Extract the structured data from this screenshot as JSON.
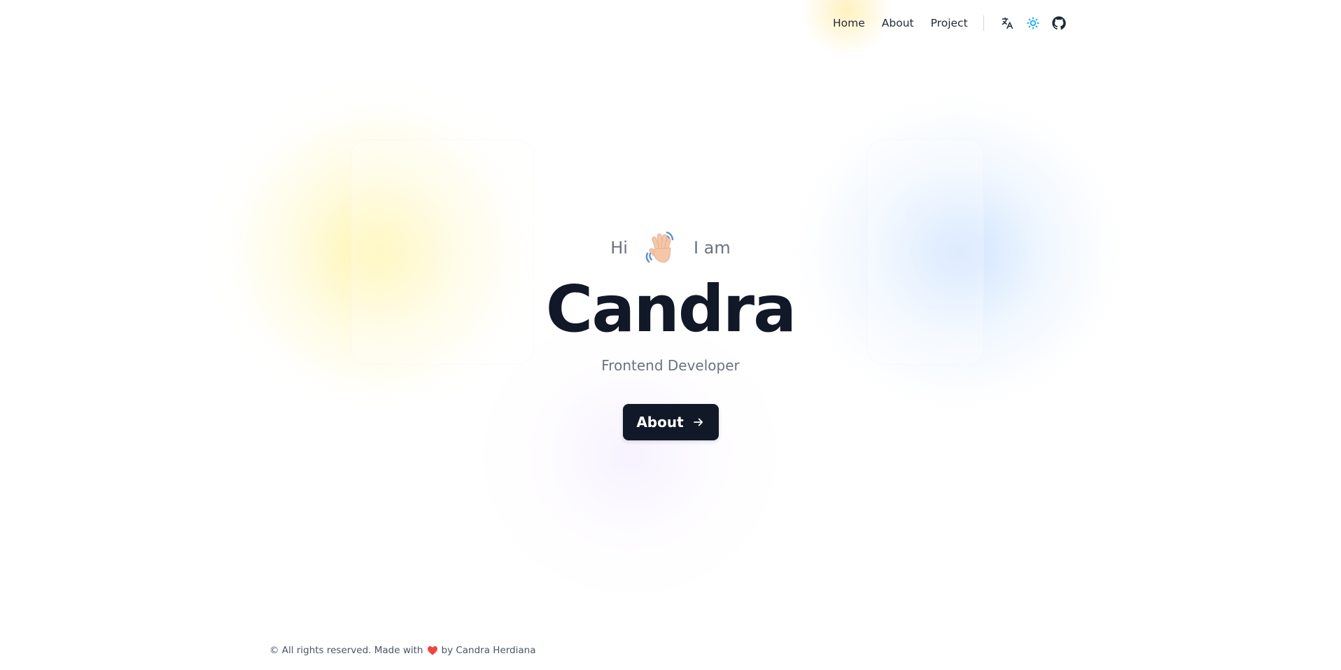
{
  "nav": {
    "links": [
      "Home",
      "About",
      "Project"
    ],
    "icons": [
      "translate-icon",
      "sun-icon",
      "github-icon"
    ],
    "sun_icon_color": "#0ea5e9"
  },
  "hero": {
    "greeting_before": "Hi",
    "wave_icon": "waving-hand-icon",
    "greeting_after": "I am",
    "name": "Candra",
    "role": "Frontend Developer",
    "cta_label": "About",
    "cta_icon": "arrow-right-icon"
  },
  "footer": {
    "text_before": "© All rights reserved. Made with",
    "heart_icon": "heart-icon",
    "text_after": "by Candra Herdiana"
  },
  "colors": {
    "primary_dark": "#111827",
    "muted_text": "#6b7280",
    "heart": "#ef4444",
    "glow_yellow": "#fff0a0",
    "glow_blue": "#a8cdff",
    "glow_purple": "#e0d0ff"
  }
}
